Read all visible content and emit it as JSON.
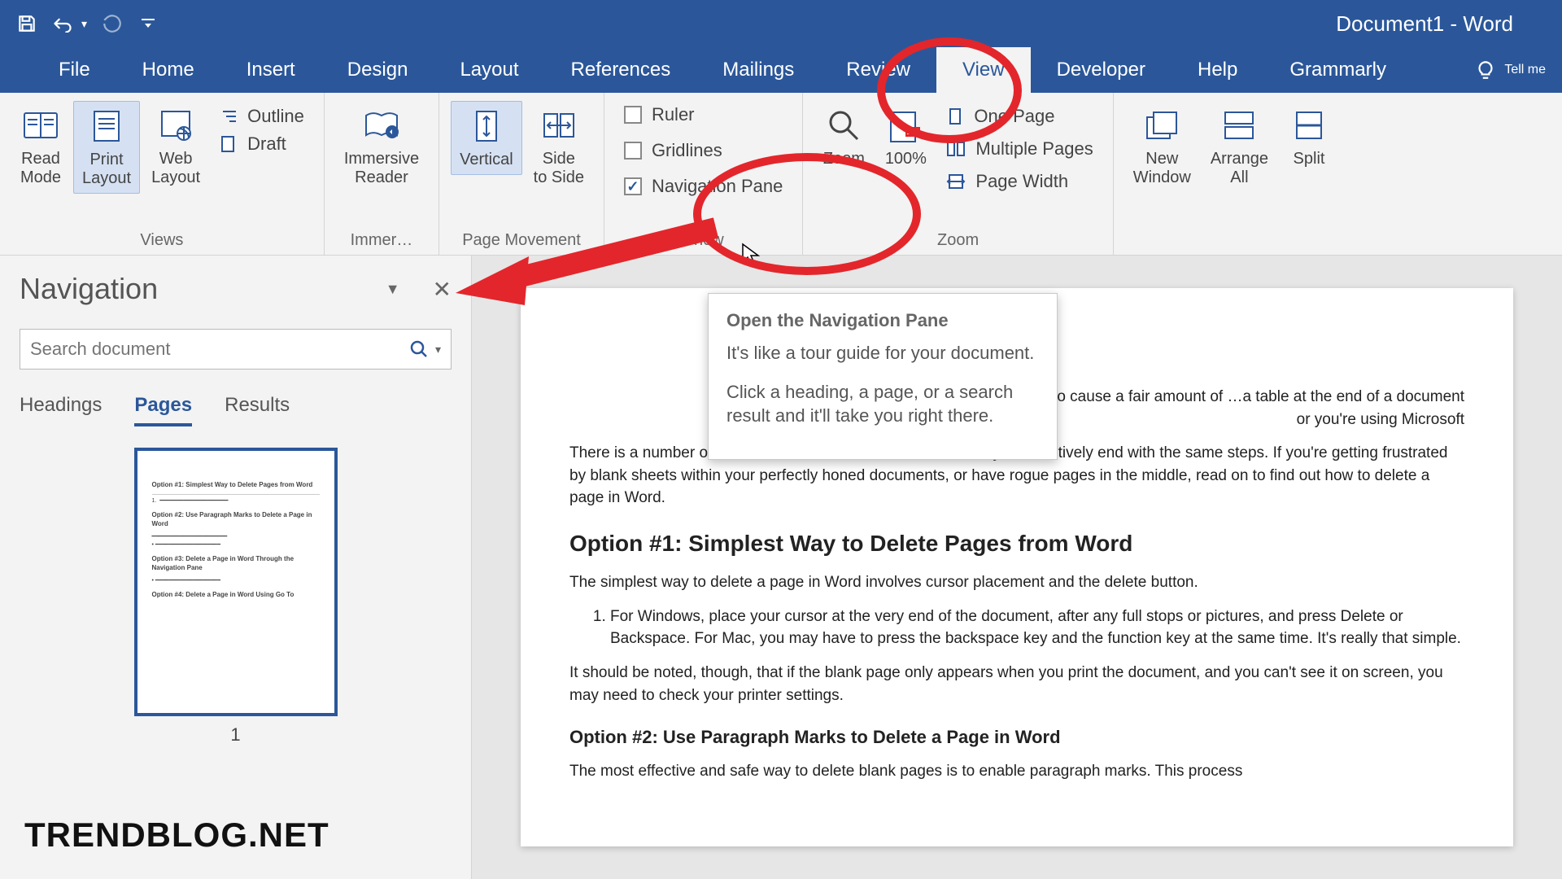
{
  "title": "Document1 - Word",
  "qat": {
    "save": "save-icon",
    "undo": "undo-icon",
    "redo": "redo-icon",
    "customize": "customize-icon"
  },
  "tabs": [
    "File",
    "Home",
    "Insert",
    "Design",
    "Layout",
    "References",
    "Mailings",
    "Review",
    "View",
    "Developer",
    "Help",
    "Grammarly"
  ],
  "active_tab": "View",
  "tellme": "Tell me",
  "ribbon": {
    "views": {
      "label": "Views",
      "read_mode": "Read\nMode",
      "print_layout": "Print\nLayout",
      "web_layout": "Web\nLayout",
      "outline": "Outline",
      "draft": "Draft"
    },
    "immersive": {
      "label": "Immer…",
      "reader": "Immersive\nReader"
    },
    "page_movement": {
      "label": "Page Movement",
      "vertical": "Vertical",
      "side": "Side\nto Side"
    },
    "show": {
      "label": "Show",
      "ruler": "Ruler",
      "gridlines": "Gridlines",
      "navpane": "Navigation Pane"
    },
    "zoom": {
      "label": "Zoom",
      "zoom": "Zoom",
      "hundred": "100%",
      "one_page": "One Page",
      "multi_pages": "Multiple Pages",
      "page_width": "Page Width"
    },
    "window": {
      "label": "",
      "new_window": "New\nWindow",
      "arrange_all": "Arrange\nAll",
      "split": "Split"
    }
  },
  "tooltip": {
    "title": "Open the Navigation Pane",
    "line1": "It's like a tour guide for your document.",
    "line2": "Click a heading, a page, or a search result and it'll take you right there."
  },
  "nav": {
    "title": "Navigation",
    "search_placeholder": "Search document",
    "tabs": {
      "headings": "Headings",
      "pages": "Pages",
      "results": "Results"
    },
    "page_num": "1"
  },
  "doc": {
    "p1": "…ete a page in Word, but it seems to cause a fair amount of …a table at the end of a document or you're using Microsoft",
    "p2": "There is a number of methods used to solve the issue, but they all effectively end with the same steps. If you're getting frustrated by blank sheets within your perfectly honed documents, or have rogue pages in the middle, read on to find out how to delete a page in Word.",
    "h1": "Option #1: Simplest Way to Delete Pages from Word",
    "p3": "The simplest way to delete a page in Word involves cursor placement and the delete button.",
    "li1": "For Windows, place your cursor at the very end of the document, after any full stops or pictures, and press Delete or Backspace. For Mac, you may have to press the backspace key and the function key at the same time. It's really that simple.",
    "p4": "It should be noted, though, that if the blank page only appears when you print the document, and you can't see it on screen, you may need to check your printer settings.",
    "h2": "Option #2: Use Paragraph Marks to Delete a Page in Word",
    "p5": "The most effective and safe way to delete blank pages is to enable paragraph marks. This process"
  },
  "watermark": "TRENDBLOG.NET"
}
